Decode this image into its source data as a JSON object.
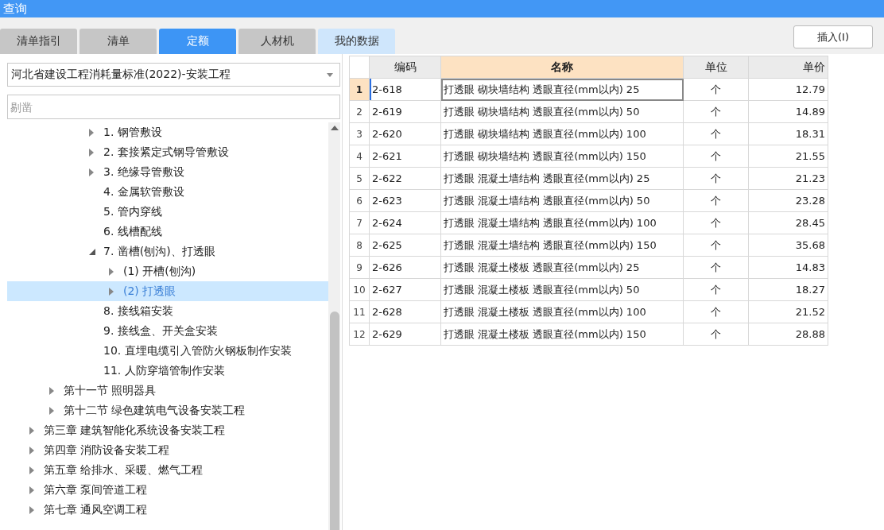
{
  "window": {
    "title": "查询"
  },
  "tabs": [
    {
      "label": "清单指引",
      "selected": false,
      "highlighted": false
    },
    {
      "label": "清单",
      "selected": false,
      "highlighted": false
    },
    {
      "label": "定额",
      "selected": true,
      "highlighted": false
    },
    {
      "label": "人材机",
      "selected": false,
      "highlighted": false
    },
    {
      "label": "我的数据",
      "selected": false,
      "highlighted": true
    }
  ],
  "insert_button": "插入(I)",
  "library_dropdown": {
    "value": "河北省建设工程消耗量标准(2022)-安装工程"
  },
  "search": {
    "placeholder": "剔凿"
  },
  "tree": {
    "nodes": [
      {
        "children": [
          {
            "children": [
              {
                "children": [
                  {
                    "label": "1. 钢管敷设",
                    "expanded": false,
                    "selected": false
                  },
                  {
                    "label": "2. 套接紧定式钢导管敷设",
                    "expanded": false,
                    "selected": false
                  },
                  {
                    "label": "3. 绝缘导管敷设",
                    "expanded": false,
                    "selected": false
                  },
                  {
                    "label": "4. 金属软管敷设",
                    "selected": false
                  },
                  {
                    "label": "5. 管内穿线",
                    "selected": false
                  },
                  {
                    "label": "6. 线槽配线",
                    "selected": false
                  },
                  {
                    "label": "7. 凿槽(刨沟)、打透眼",
                    "expanded": true,
                    "selected": false,
                    "children": [
                      {
                        "label": "(1) 开槽(刨沟)",
                        "expanded": false,
                        "selected": false
                      },
                      {
                        "label": "(2) 打透眼",
                        "expanded": false,
                        "selected": true
                      }
                    ]
                  },
                  {
                    "label": "8. 接线箱安装",
                    "selected": false
                  },
                  {
                    "label": "9. 接线盒、开关盒安装",
                    "selected": false
                  },
                  {
                    "label": "10. 直埋电缆引入管防火钢板制作安装",
                    "selected": false
                  },
                  {
                    "label": "11. 人防穿墙管制作安装",
                    "selected": false
                  }
                ]
              }
            ]
          },
          {
            "label": "第十一节 照明器具",
            "expanded": false,
            "selected": false
          },
          {
            "label": "第十二节 绿色建筑电气设备安装工程",
            "expanded": false,
            "selected": false
          }
        ]
      },
      {
        "label": "第三章 建筑智能化系统设备安装工程",
        "expanded": false,
        "selected": false
      },
      {
        "label": "第四章 消防设备安装工程",
        "expanded": false,
        "selected": false
      },
      {
        "label": "第五章 给排水、采暖、燃气工程",
        "expanded": false,
        "selected": false
      },
      {
        "label": "第六章 泵间管道工程",
        "expanded": false,
        "selected": false
      },
      {
        "label": "第七章 通风空调工程",
        "expanded": false,
        "selected": false
      }
    ]
  },
  "table": {
    "columns": [
      "编码",
      "名称",
      "单位",
      "单价"
    ],
    "rows": [
      {
        "index": "1",
        "code": "2-618",
        "name": "打透眼 砌块墙结构 透眼直径(mm以内) 25",
        "unit": "个",
        "price": "12.79",
        "selected": true
      },
      {
        "index": "2",
        "code": "2-619",
        "name": "打透眼 砌块墙结构 透眼直径(mm以内) 50",
        "unit": "个",
        "price": "14.89",
        "selected": false
      },
      {
        "index": "3",
        "code": "2-620",
        "name": "打透眼 砌块墙结构 透眼直径(mm以内) 100",
        "unit": "个",
        "price": "18.31",
        "selected": false
      },
      {
        "index": "4",
        "code": "2-621",
        "name": "打透眼 砌块墙结构 透眼直径(mm以内) 150",
        "unit": "个",
        "price": "21.55",
        "selected": false
      },
      {
        "index": "5",
        "code": "2-622",
        "name": "打透眼 混凝土墙结构 透眼直径(mm以内) 25",
        "unit": "个",
        "price": "21.23",
        "selected": false
      },
      {
        "index": "6",
        "code": "2-623",
        "name": "打透眼 混凝土墙结构 透眼直径(mm以内) 50",
        "unit": "个",
        "price": "23.28",
        "selected": false
      },
      {
        "index": "7",
        "code": "2-624",
        "name": "打透眼 混凝土墙结构 透眼直径(mm以内) 100",
        "unit": "个",
        "price": "28.45",
        "selected": false
      },
      {
        "index": "8",
        "code": "2-625",
        "name": "打透眼 混凝土墙结构 透眼直径(mm以内) 150",
        "unit": "个",
        "price": "35.68",
        "selected": false
      },
      {
        "index": "9",
        "code": "2-626",
        "name": "打透眼 混凝土楼板 透眼直径(mm以内) 25",
        "unit": "个",
        "price": "14.83",
        "selected": false
      },
      {
        "index": "10",
        "code": "2-627",
        "name": "打透眼 混凝土楼板 透眼直径(mm以内) 50",
        "unit": "个",
        "price": "18.27",
        "selected": false
      },
      {
        "index": "11",
        "code": "2-628",
        "name": "打透眼 混凝土楼板 透眼直径(mm以内) 100",
        "unit": "个",
        "price": "21.52",
        "selected": false
      },
      {
        "index": "12",
        "code": "2-629",
        "name": "打透眼 混凝土楼板 透眼直径(mm以内) 150",
        "unit": "个",
        "price": "28.88",
        "selected": false
      }
    ]
  }
}
